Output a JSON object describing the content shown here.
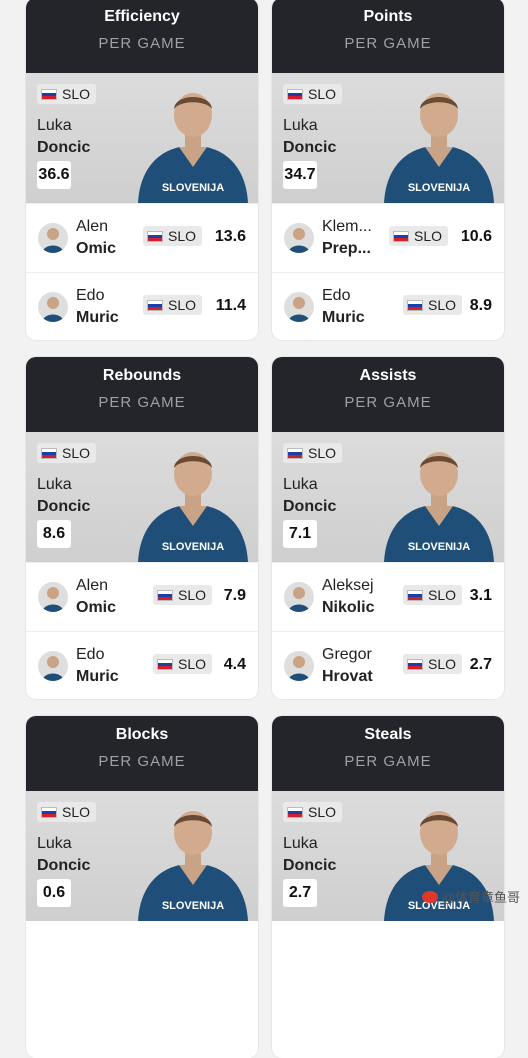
{
  "cards": [
    {
      "title": "Efficiency",
      "subtitle": "PER GAME",
      "leader": {
        "first": "Luka",
        "last": "Doncic",
        "country": "SLO",
        "value": "36.6",
        "jersey": "SLOVENIJA"
      },
      "rows": [
        {
          "first": "Alen",
          "last": "Omic",
          "country": "SLO",
          "value": "13.6"
        },
        {
          "first": "Edo",
          "last": "Muric",
          "country": "SLO",
          "value": "11.4"
        }
      ]
    },
    {
      "title": "Points",
      "subtitle": "PER GAME",
      "leader": {
        "first": "Luka",
        "last": "Doncic",
        "country": "SLO",
        "value": "34.7",
        "jersey": "SLOVENIJA"
      },
      "rows": [
        {
          "first": "Klem...",
          "last": "Prep...",
          "country": "SLO",
          "value": "10.6"
        },
        {
          "first": "Edo",
          "last": "Muric",
          "country": "SLO",
          "value": "8.9"
        }
      ]
    },
    {
      "title": "Rebounds",
      "subtitle": "PER GAME",
      "leader": {
        "first": "Luka",
        "last": "Doncic",
        "country": "SLO",
        "value": "8.6",
        "jersey": "SLOVENIJA"
      },
      "rows": [
        {
          "first": "Alen",
          "last": "Omic",
          "country": "SLO",
          "value": "7.9"
        },
        {
          "first": "Edo",
          "last": "Muric",
          "country": "SLO",
          "value": "4.4"
        }
      ]
    },
    {
      "title": "Assists",
      "subtitle": "PER GAME",
      "leader": {
        "first": "Luka",
        "last": "Doncic",
        "country": "SLO",
        "value": "7.1",
        "jersey": "SLOVENIJA"
      },
      "rows": [
        {
          "first": "Aleksej",
          "last": "Nikolic",
          "country": "SLO",
          "value": "3.1"
        },
        {
          "first": "Gregor",
          "last": "Hrovat",
          "country": "SLO",
          "value": "2.7"
        }
      ]
    },
    {
      "title": "Blocks",
      "subtitle": "PER GAME",
      "leader": {
        "first": "Luka",
        "last": "Doncic",
        "country": "SLO",
        "value": "0.6",
        "jersey": "SLOVENIJA"
      },
      "rows": []
    },
    {
      "title": "Steals",
      "subtitle": "PER GAME",
      "leader": {
        "first": "Luka",
        "last": "Doncic",
        "country": "SLO",
        "value": "2.7",
        "jersey": "SLOVENIJA"
      },
      "rows": []
    }
  ],
  "watermark": "@体育章鱼哥",
  "colors": {
    "header_bg": "#23252b",
    "card_bg": "#ffffff",
    "page_bg": "#f2f2f2",
    "jersey": "#1f4f78"
  }
}
